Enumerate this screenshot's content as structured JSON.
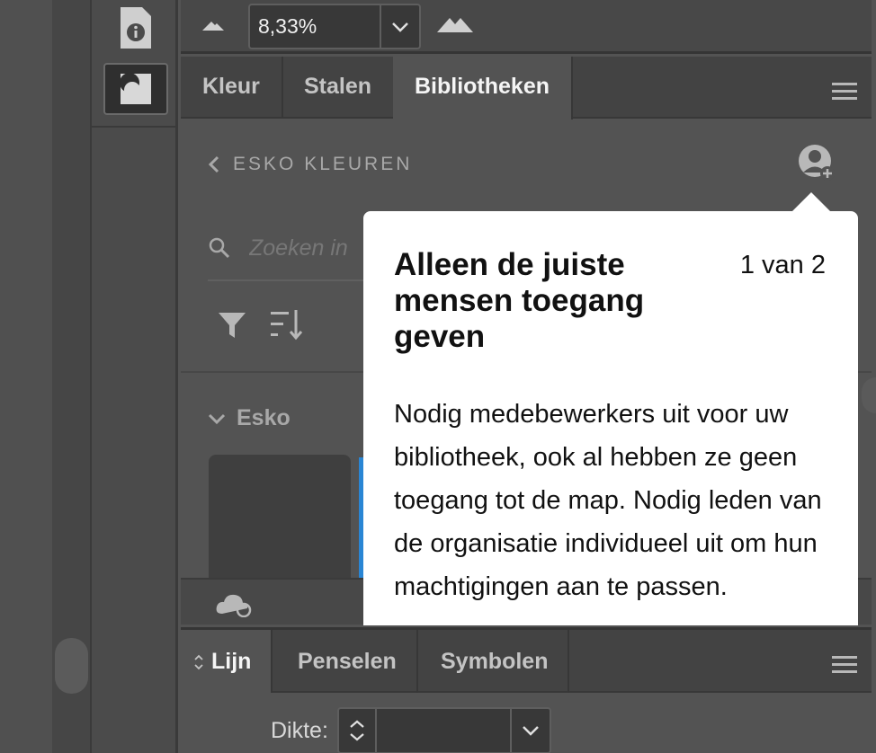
{
  "toolbar": {
    "zoom_value": "8,33%"
  },
  "color_panel": {
    "tabs": [
      {
        "label": "Kleur"
      },
      {
        "label": "Stalen"
      },
      {
        "label": "Bibliotheken"
      }
    ],
    "active_tab": "Bibliotheken",
    "library_name": "ESKO KLEUREN",
    "search_placeholder": "Zoeken in",
    "group_name": "Esko"
  },
  "popover": {
    "title": "Alleen de juiste mensen toegang geven",
    "counter": "1 van 2",
    "body": "Nodig medebewerkers uit voor uw bibliotheek, ook al hebben ze geen toegang tot de map. Nodig leden van de organisatie individueel uit om hun machtigingen aan te passen."
  },
  "stroke_panel": {
    "tabs": [
      {
        "label": "Lijn"
      },
      {
        "label": "Penselen"
      },
      {
        "label": "Symbolen"
      }
    ],
    "active_tab": "Lijn",
    "dikte_label": "Dikte:",
    "dikte_value": ""
  },
  "colors": {
    "accent_blue": "#2a86d4",
    "panel_bg": "#535353",
    "popover_bg": "#ffffff"
  }
}
